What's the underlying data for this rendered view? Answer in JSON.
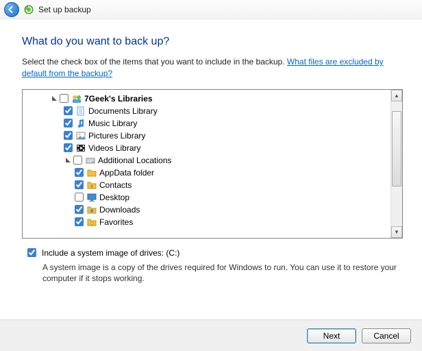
{
  "window": {
    "title": "Set up backup"
  },
  "heading": "What do you want to back up?",
  "instruction_prefix": "Select the check box of the items that you want to include in the backup. ",
  "link_text": "What files are excluded by default from the backup?",
  "tree": {
    "root": {
      "label": "7Geek's Libraries",
      "children": [
        {
          "label": "Documents Library",
          "icon": "doc",
          "checked": true
        },
        {
          "label": "Music Library",
          "icon": "music",
          "checked": true
        },
        {
          "label": "Pictures Library",
          "icon": "pic",
          "checked": true
        },
        {
          "label": "Videos Library",
          "icon": "vid",
          "checked": true
        }
      ],
      "additional": {
        "label": "Additional Locations",
        "children": [
          {
            "label": "AppData folder",
            "icon": "folder",
            "checked": true
          },
          {
            "label": "Contacts",
            "icon": "folder",
            "checked": true
          },
          {
            "label": "Desktop",
            "icon": "desk",
            "checked": false
          },
          {
            "label": "Downloads",
            "icon": "down",
            "checked": true
          },
          {
            "label": "Favorites",
            "icon": "star",
            "checked": true
          }
        ]
      }
    }
  },
  "system_image": {
    "checked": true,
    "label": "Include a system image of drives: (C:)",
    "description": "A system image is a copy of the drives required for Windows to run. You can use it to restore your computer if it stops working."
  },
  "buttons": {
    "next": "Next",
    "cancel": "Cancel"
  }
}
